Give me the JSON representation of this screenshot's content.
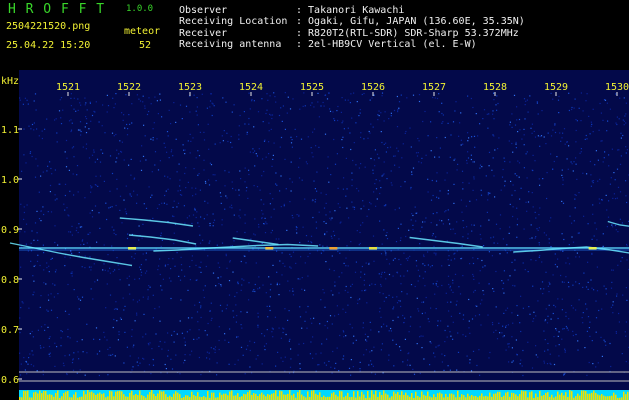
{
  "app": {
    "title": "H R O F F T",
    "version": "1.0.0",
    "filename": "2504221520.png",
    "datetime": "25.04.22 15:20",
    "meteor_label": "meteor",
    "meteor_count": "52"
  },
  "station": {
    "observer_label": "Observer",
    "observer": ": Takanori Kawachi",
    "location_label": "Receiving Location",
    "location": ": Ogaki, Gifu, JAPAN (136.60E, 35.35N)",
    "receiver_label": "Receiver",
    "receiver": ": R820T2(RTL-SDR) SDR-Sharp 53.372MHz",
    "antenna_label": "Receiving antenna",
    "antenna": ": 2el-HB9CV Vertical (el. E-W)"
  },
  "colors": {
    "background": "#000000",
    "plot_background": "#03094a",
    "title_green": "#39d62a",
    "label_yellow": "#f2f233",
    "header_white": "#f0f0f0",
    "baseline_cyan": "#00d8ff",
    "baseline_yellow": "#f0e000"
  },
  "chart_data": {
    "type": "heatmap",
    "y_unit": "kHz",
    "x_ticks": [
      "1521",
      "1522",
      "1523",
      "1524",
      "1525",
      "1526",
      "1527",
      "1528",
      "1529",
      "1530"
    ],
    "y_ticks": [
      "1.1",
      "1.0",
      "0.9",
      "0.8",
      "0.7",
      "0.6"
    ],
    "ylim": [
      0.6,
      1.1
    ],
    "carrier_khz": 0.862,
    "traces": [
      {
        "x": [
          1520.05,
          1520.45,
          1520.85,
          1521.25,
          1521.65,
          1522.05
        ],
        "y": [
          0.872,
          0.862,
          0.852,
          0.843,
          0.835,
          0.827
        ]
      },
      {
        "x": [
          1521.85,
          1522.25,
          1522.65,
          1523.05
        ],
        "y": [
          0.922,
          0.918,
          0.913,
          0.906
        ]
      },
      {
        "x": [
          1522.0,
          1522.35,
          1522.75,
          1523.1
        ],
        "y": [
          0.888,
          0.884,
          0.878,
          0.87
        ]
      },
      {
        "x": [
          1522.4,
          1522.8,
          1523.2,
          1523.65,
          1524.1,
          1524.6,
          1525.1
        ],
        "y": [
          0.856,
          0.858,
          0.861,
          0.864,
          0.867,
          0.869,
          0.866
        ]
      },
      {
        "x": [
          1523.7,
          1524.05,
          1524.45
        ],
        "y": [
          0.882,
          0.876,
          0.869
        ]
      },
      {
        "x": [
          1526.6,
          1527.0,
          1527.4,
          1527.8
        ],
        "y": [
          0.883,
          0.877,
          0.871,
          0.864
        ]
      },
      {
        "x": [
          1528.3,
          1528.7,
          1529.1,
          1529.5,
          1529.9,
          1530.2
        ],
        "y": [
          0.854,
          0.857,
          0.861,
          0.864,
          0.858,
          0.852
        ]
      },
      {
        "x": [
          1529.85,
          1530.05,
          1530.35
        ],
        "y": [
          0.915,
          0.908,
          0.903
        ]
      }
    ]
  }
}
